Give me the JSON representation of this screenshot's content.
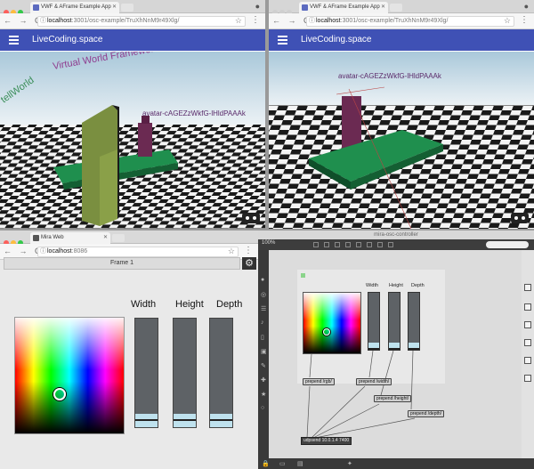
{
  "top_left": {
    "tab_title": "VWF & AFrame Example App",
    "url_host": "localhost",
    "url_path": ":3001/osc-example/TruXhNnM9r49Xlg/",
    "app_title": "LiveCoding.space",
    "avatar_label": "avatar-cAGEZzWkfG-lHldPAAAk",
    "banner_text": "Virtual World Framework & A-Frame",
    "banner_text2": "tellWorld"
  },
  "top_right": {
    "tab_title": "VWF & AFrame Example App",
    "url_host": "localhost",
    "url_path": ":3001/osc-example/TruXhNnM9r49Xlg/",
    "app_title": "LiveCoding.space",
    "avatar_label": "avatar-cAGEZzWkfG-lHldPAAAk"
  },
  "bottom_left": {
    "tab_title": "Mira Web",
    "url_host": "localhost",
    "url_path": ":8086",
    "frame_title": "Frame 1",
    "width_label": "Width",
    "height_label": "Height",
    "depth_label": "Depth",
    "width_value": 0.12,
    "height_value": 0.12,
    "depth_value": 0.12
  },
  "bottom_right": {
    "window_title": "mira-osc-controller",
    "zoom": "100%",
    "width_label": "Width",
    "height_label": "Height",
    "depth_label": "Depth",
    "msg_rgb": "prepend /rgb/",
    "msg_width": "prepend /width/",
    "msg_height": "prepend /height/",
    "msg_depth": "prepend /depth/",
    "udpsend": "udpsend 10.0.1.4 7400"
  },
  "colors": {
    "appbar": "#3f51b5",
    "ground_green": "#1f8f4e",
    "slider_fill": "#bfe2ee"
  }
}
